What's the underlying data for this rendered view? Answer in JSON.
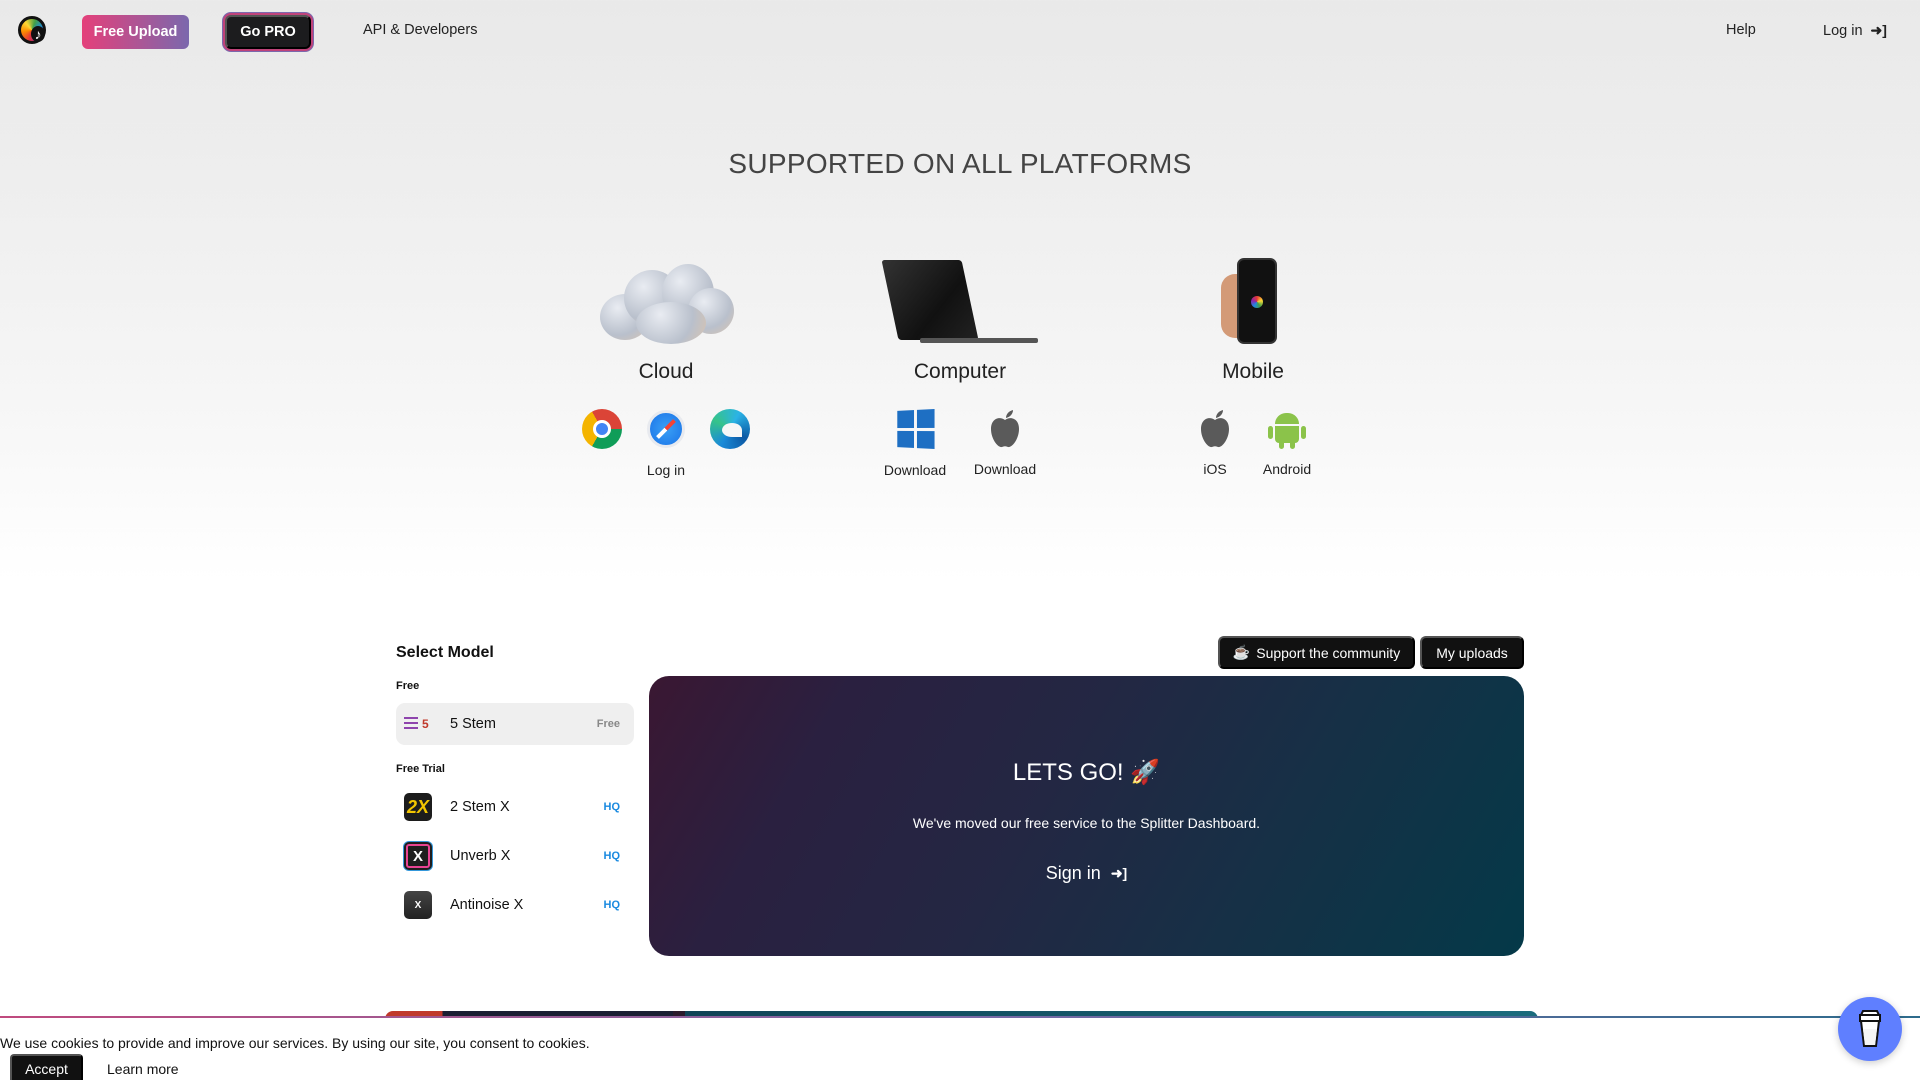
{
  "nav": {
    "logo_icon": "music-note-logo-icon",
    "free_upload": "Free Upload",
    "go_pro": "Go PRO",
    "api": "API & Developers",
    "help": "Help",
    "login": "Log in",
    "login_icon": "sign-in-icon",
    "colors": {
      "free_upload_gradient": [
        "#e4407a",
        "#7b68ad"
      ],
      "go_pro_bg": "#1c1c1e"
    }
  },
  "platforms": {
    "title": "SUPPORTED ON ALL PLATFORMS",
    "items": [
      {
        "name": "Cloud",
        "image": "cloud-image",
        "links": [
          {
            "icon": "chrome-icon"
          },
          {
            "icon": "safari-icon",
            "label": "Log in"
          },
          {
            "icon": "edge-icon"
          }
        ]
      },
      {
        "name": "Computer",
        "image": "laptop-image",
        "links": [
          {
            "icon": "windows-icon",
            "label": "Download"
          },
          {
            "icon": "apple-icon",
            "label": "Download"
          }
        ]
      },
      {
        "name": "Mobile",
        "image": "phone-in-hand-image",
        "links": [
          {
            "icon": "apple-icon",
            "label": "iOS"
          },
          {
            "icon": "android-icon",
            "label": "Android"
          }
        ]
      }
    ]
  },
  "models": {
    "title": "Select Model",
    "groups": [
      {
        "label": "Free",
        "items": [
          {
            "name": "5 Stem",
            "icon_text": "5",
            "tag": "Free",
            "selected": true
          }
        ]
      },
      {
        "label": "Free Trial",
        "items": [
          {
            "name": "2 Stem X",
            "icon_text": "2X",
            "tag": "HQ"
          },
          {
            "name": "Unverb X",
            "icon_text": "X",
            "tag": "HQ"
          },
          {
            "name": "Antinoise X",
            "icon_text": "X",
            "tag": "HQ"
          }
        ]
      }
    ]
  },
  "actions": {
    "support": "Support the community",
    "support_icon": "coffee-cup-icon",
    "uploads": "My uploads"
  },
  "hero": {
    "title": "LETS GO! 🚀",
    "message": "We've moved our free service to the Splitter Dashboard.",
    "signin": "Sign in",
    "colors": [
      "#3a1732",
      "#232743",
      "#043948"
    ]
  },
  "cookie": {
    "text": "We use cookies to provide and improve our services. By using our site, you consent to cookies.",
    "accept": "Accept",
    "learn_more": "Learn more"
  },
  "floating": {
    "icon": "buy-me-a-coffee-icon",
    "color": "#5f7fff"
  }
}
